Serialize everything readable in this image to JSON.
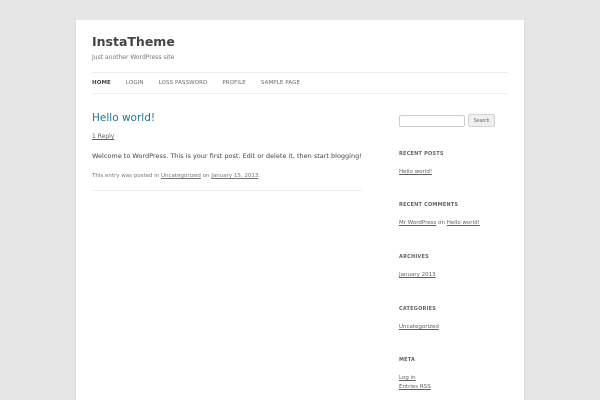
{
  "site": {
    "title": "InstaTheme",
    "description": "Just another WordPress site"
  },
  "nav": {
    "items": [
      {
        "label": "HOME",
        "current": true
      },
      {
        "label": "LOGIN"
      },
      {
        "label": "LOSS PASSWORD"
      },
      {
        "label": "PROFILE"
      },
      {
        "label": "SAMPLE PAGE"
      }
    ]
  },
  "post": {
    "title": "Hello world!",
    "reply": "1 Reply",
    "content": "Welcome to WordPress. This is your first post. Edit or delete it, then start blogging!",
    "meta_prefix": "This entry was posted in",
    "category": "Uncategorized",
    "meta_on": "on",
    "date": "January 15, 2013",
    "meta_suffix": "."
  },
  "sidebar": {
    "search": {
      "placeholder": "",
      "button": "Search"
    },
    "recent_posts": {
      "title": "RECENT POSTS",
      "items": [
        "Hello world!"
      ]
    },
    "recent_comments": {
      "title": "RECENT COMMENTS",
      "author": "Mr WordPress",
      "on": "on",
      "post": "Hello world!"
    },
    "archives": {
      "title": "ARCHIVES",
      "items": [
        "January 2013"
      ]
    },
    "categories": {
      "title": "CATEGORIES",
      "items": [
        "Uncategorized"
      ]
    },
    "meta": {
      "title": "META",
      "items": [
        "Log in",
        "Entries RSS"
      ]
    }
  }
}
